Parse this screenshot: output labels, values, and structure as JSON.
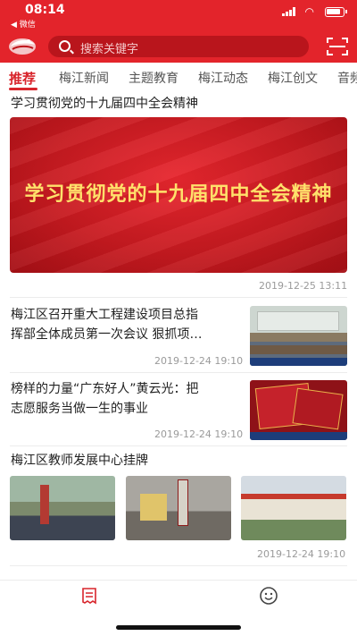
{
  "status_bar": {
    "time": "08:14",
    "back_label": "◀ 微信"
  },
  "search": {
    "placeholder": "搜索关键字"
  },
  "tabs": [
    {
      "label": "推荐",
      "active": true
    },
    {
      "label": "梅江新闻"
    },
    {
      "label": "主题教育"
    },
    {
      "label": "梅江动态"
    },
    {
      "label": "梅江创文"
    },
    {
      "label": "音频"
    }
  ],
  "feed": [
    {
      "title": "学习贯彻党的十九届四中全会精神",
      "banner_text": "学习贯彻党的十九届四中全会精神",
      "date": "2019-12-25 13:11"
    },
    {
      "title_line1": "梅江区召开重大工程建设项目总指",
      "title_line2": "挥部全体成员第一次会议 狠抓项…",
      "date": "2019-12-24 19:10"
    },
    {
      "title_line1": "榜样的力量“广东好人”黄云光：把",
      "title_line2": "志愿服务当做一生的事业",
      "date": "2019-12-24 19:10"
    },
    {
      "title": "梅江区教师发展中心挂牌",
      "date": "2019-12-24 19:10"
    }
  ],
  "colors": {
    "brand_red": "#e3242b",
    "active_tab": "#d8252c",
    "banner_text": "#ffe16b"
  },
  "icons": {
    "logo": "app-logo-icon",
    "search": "search-icon",
    "scan": "scan-icon",
    "nav_news": "news-icon",
    "nav_me": "smiley-icon"
  }
}
